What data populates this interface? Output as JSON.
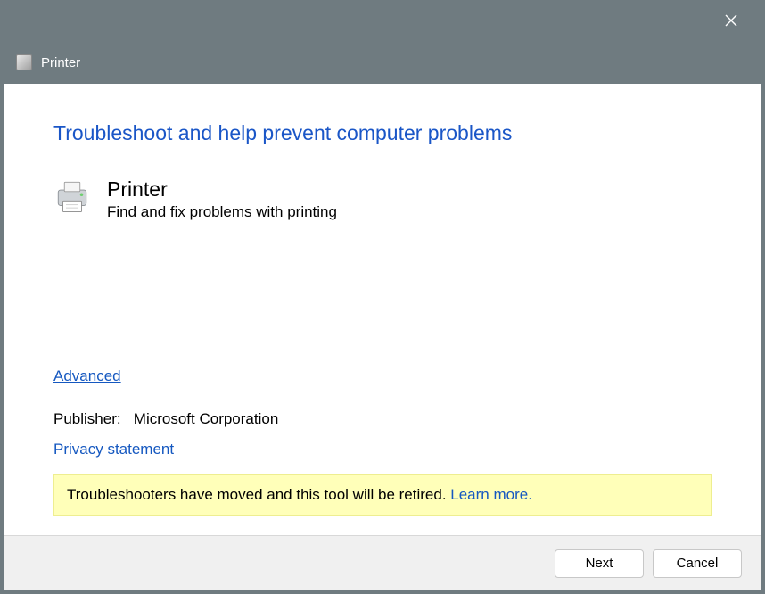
{
  "titlebar": {
    "window_title": "Printer"
  },
  "main": {
    "heading": "Troubleshoot and help prevent computer problems",
    "section": {
      "title": "Printer",
      "description": "Find and fix problems with printing"
    },
    "advanced_label": "Advanced",
    "publisher_label": "Publisher:",
    "publisher_value": "Microsoft Corporation",
    "privacy_label": "Privacy statement",
    "banner": {
      "text": "Troubleshooters have moved and this tool will be retired. ",
      "learn_more": "Learn more."
    }
  },
  "buttons": {
    "next": "Next",
    "cancel": "Cancel"
  }
}
